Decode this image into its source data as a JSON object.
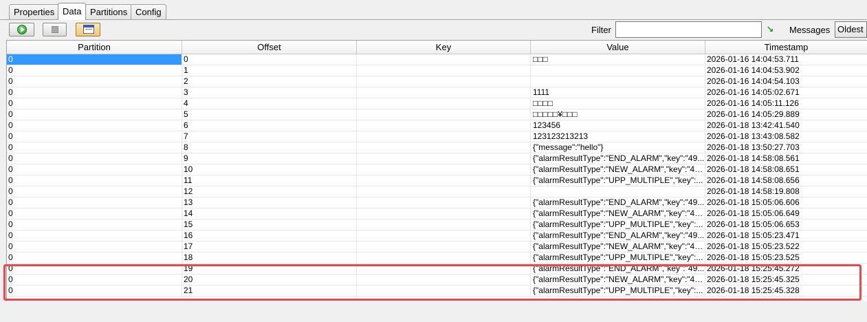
{
  "tabs": [
    {
      "label": "Properties",
      "active": false
    },
    {
      "label": "Data",
      "active": true
    },
    {
      "label": "Partitions",
      "active": false
    },
    {
      "label": "Config",
      "active": false
    }
  ],
  "toolbar": {
    "play_icon": "play-icon",
    "stop_icon": "stop-icon",
    "view_icon": "view-icon",
    "filter_label": "Filter",
    "filter_value": "",
    "filter_placeholder": "",
    "apply_icon_glyph": "↘",
    "messages_label": "Messages",
    "messages_selected": "Oldest"
  },
  "columns": [
    "Partition",
    "Offset",
    "Key",
    "Value",
    "Timestamp"
  ],
  "rows": [
    {
      "partition": "0",
      "offset": "0",
      "key": "",
      "value": "□□□",
      "timestamp": "2026-01-16 14:04:53.711"
    },
    {
      "partition": "0",
      "offset": "1",
      "key": "",
      "value": "",
      "timestamp": "2026-01-16 14:04:53.902"
    },
    {
      "partition": "0",
      "offset": "2",
      "key": "",
      "value": "",
      "timestamp": "2026-01-16 14:04:54.103"
    },
    {
      "partition": "0",
      "offset": "3",
      "key": "",
      "value": "1111",
      "timestamp": "2026-01-16 14:05:02.671"
    },
    {
      "partition": "0",
      "offset": "4",
      "key": "",
      "value": "□□□□",
      "timestamp": "2026-01-16 14:05:11.126"
    },
    {
      "partition": "0",
      "offset": "5",
      "key": "",
      "value": "□□□□□¥□□□",
      "timestamp": "2026-01-16 14:05:29.889"
    },
    {
      "partition": "0",
      "offset": "6",
      "key": "",
      "value": "123456",
      "timestamp": "2026-01-18 13:42:41.540"
    },
    {
      "partition": "0",
      "offset": "7",
      "key": "",
      "value": "123123213213",
      "timestamp": "2026-01-18 13:43:08.582"
    },
    {
      "partition": "0",
      "offset": "8",
      "key": "",
      "value": "{\"message\":\"hello\"}",
      "timestamp": "2026-01-18 13:50:27.703"
    },
    {
      "partition": "0",
      "offset": "9",
      "key": "",
      "value": "{\"alarmResultType\":\"END_ALARM\",\"key\":\"49...",
      "timestamp": "2026-01-18 14:58:08.561"
    },
    {
      "partition": "0",
      "offset": "10",
      "key": "",
      "value": "{\"alarmResultType\":\"NEW_ALARM\",\"key\":\"49...",
      "timestamp": "2026-01-18 14:58:08.651"
    },
    {
      "partition": "0",
      "offset": "11",
      "key": "",
      "value": "{\"alarmResultType\":\"UPP_MULTIPLE\",\"key\":...",
      "timestamp": "2026-01-18 14:58:08.656"
    },
    {
      "partition": "0",
      "offset": "12",
      "key": "",
      "value": "",
      "timestamp": "2026-01-18 14:58:19.808"
    },
    {
      "partition": "0",
      "offset": "13",
      "key": "",
      "value": "{\"alarmResultType\":\"END_ALARM\",\"key\":\"49...",
      "timestamp": "2026-01-18 15:05:06.606"
    },
    {
      "partition": "0",
      "offset": "14",
      "key": "",
      "value": "{\"alarmResultType\":\"NEW_ALARM\",\"key\":\"49...",
      "timestamp": "2026-01-18 15:05:06.649"
    },
    {
      "partition": "0",
      "offset": "15",
      "key": "",
      "value": "{\"alarmResultType\":\"UPP_MULTIPLE\",\"key\":...",
      "timestamp": "2026-01-18 15:05:06.653"
    },
    {
      "partition": "0",
      "offset": "16",
      "key": "",
      "value": "{\"alarmResultType\":\"END_ALARM\",\"key\":\"49...",
      "timestamp": "2026-01-18 15:05:23.471"
    },
    {
      "partition": "0",
      "offset": "17",
      "key": "",
      "value": "{\"alarmResultType\":\"NEW_ALARM\",\"key\":\"49...",
      "timestamp": "2026-01-18 15:05:23.522"
    },
    {
      "partition": "0",
      "offset": "18",
      "key": "",
      "value": "{\"alarmResultType\":\"UPP_MULTIPLE\",\"key\":...",
      "timestamp": "2026-01-18 15:05:23.525"
    },
    {
      "partition": "0",
      "offset": "19",
      "key": "",
      "value": "{\"alarmResultType\":\"END_ALARM\",\"key\":\"49...",
      "timestamp": "2026-01-18 15:25:45.272"
    },
    {
      "partition": "0",
      "offset": "20",
      "key": "",
      "value": "{\"alarmResultType\":\"NEW_ALARM\",\"key\":\"49...",
      "timestamp": "2026-01-18 15:25:45.325"
    },
    {
      "partition": "0",
      "offset": "21",
      "key": "",
      "value": "{\"alarmResultType\":\"UPP_MULTIPLE\",\"key\":...",
      "timestamp": "2026-01-18 15:25:45.328"
    }
  ],
  "selected_row_index": 0,
  "highlight_color": "#e8474f",
  "selection_color": "#3399ff"
}
